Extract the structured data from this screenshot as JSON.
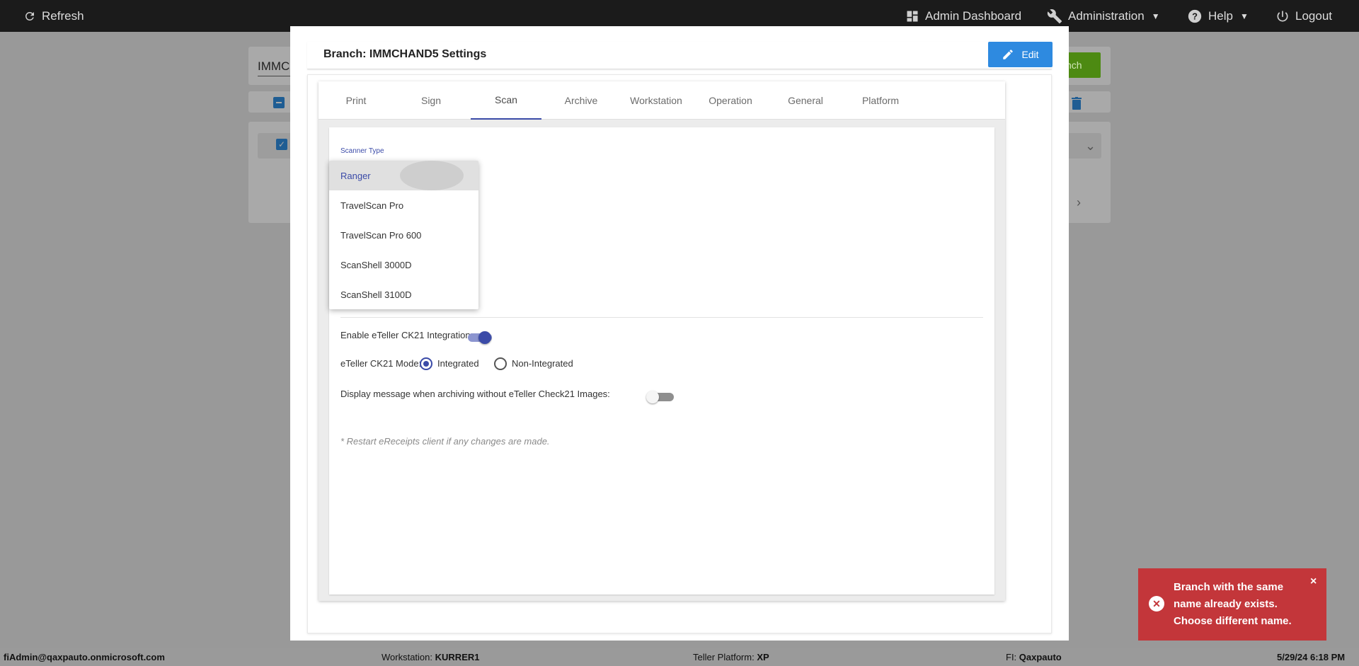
{
  "topbar": {
    "refresh_label": "Refresh",
    "admin_dashboard_label": "Admin Dashboard",
    "administration_label": "Administration",
    "help_label": "Help",
    "logout_label": "Logout"
  },
  "background": {
    "search_text": "IMMC",
    "add_branch_label": "nch"
  },
  "modal": {
    "title": "Branch: IMMCHAND5 Settings",
    "edit_label": "Edit",
    "tabs": [
      {
        "label": "Print"
      },
      {
        "label": "Sign"
      },
      {
        "label": "Scan"
      },
      {
        "label": "Archive"
      },
      {
        "label": "Workstation"
      },
      {
        "label": "Operation"
      },
      {
        "label": "General"
      },
      {
        "label": "Platform"
      }
    ],
    "active_tab": "Scan",
    "scanner_type_label": "Scanner Type",
    "scanner_type_selected": "Ranger",
    "scanner_options": [
      "Ranger",
      "TravelScan Pro",
      "TravelScan Pro 600",
      "ScanShell 3000D",
      "ScanShell 3100D"
    ],
    "ck21_integration_label": "Enable eTeller CK21 Integration:",
    "ck21_integration_enabled": true,
    "ck21_mode_label": "eTeller CK21 Mode:",
    "ck21_mode_options": [
      "Integrated",
      "Non-Integrated"
    ],
    "ck21_mode_selected": "Integrated",
    "archive_message_label": "Display message when archiving without eTeller Check21 Images:",
    "archive_message_enabled": false,
    "restart_note": "* Restart eReceipts client if any changes are made."
  },
  "toast": {
    "message": "Branch with the same name already exists. Choose different name.",
    "close_symbol": "×",
    "color": "#c3363a"
  },
  "statusbar": {
    "user": "fiAdmin@qaxpauto.onmicrosoft.com",
    "workstation_label": "Workstation:",
    "workstation_value": "KURRER1",
    "platform_label": "Teller Platform:",
    "platform_value": "XP",
    "fi_label": "FI:",
    "fi_value": "Qaxpauto",
    "datetime": "5/29/24 6:18 PM"
  },
  "colors": {
    "accent": "#3b4ba8",
    "edit_button": "#2e8ae0",
    "topbar": "#1b1b1b"
  }
}
